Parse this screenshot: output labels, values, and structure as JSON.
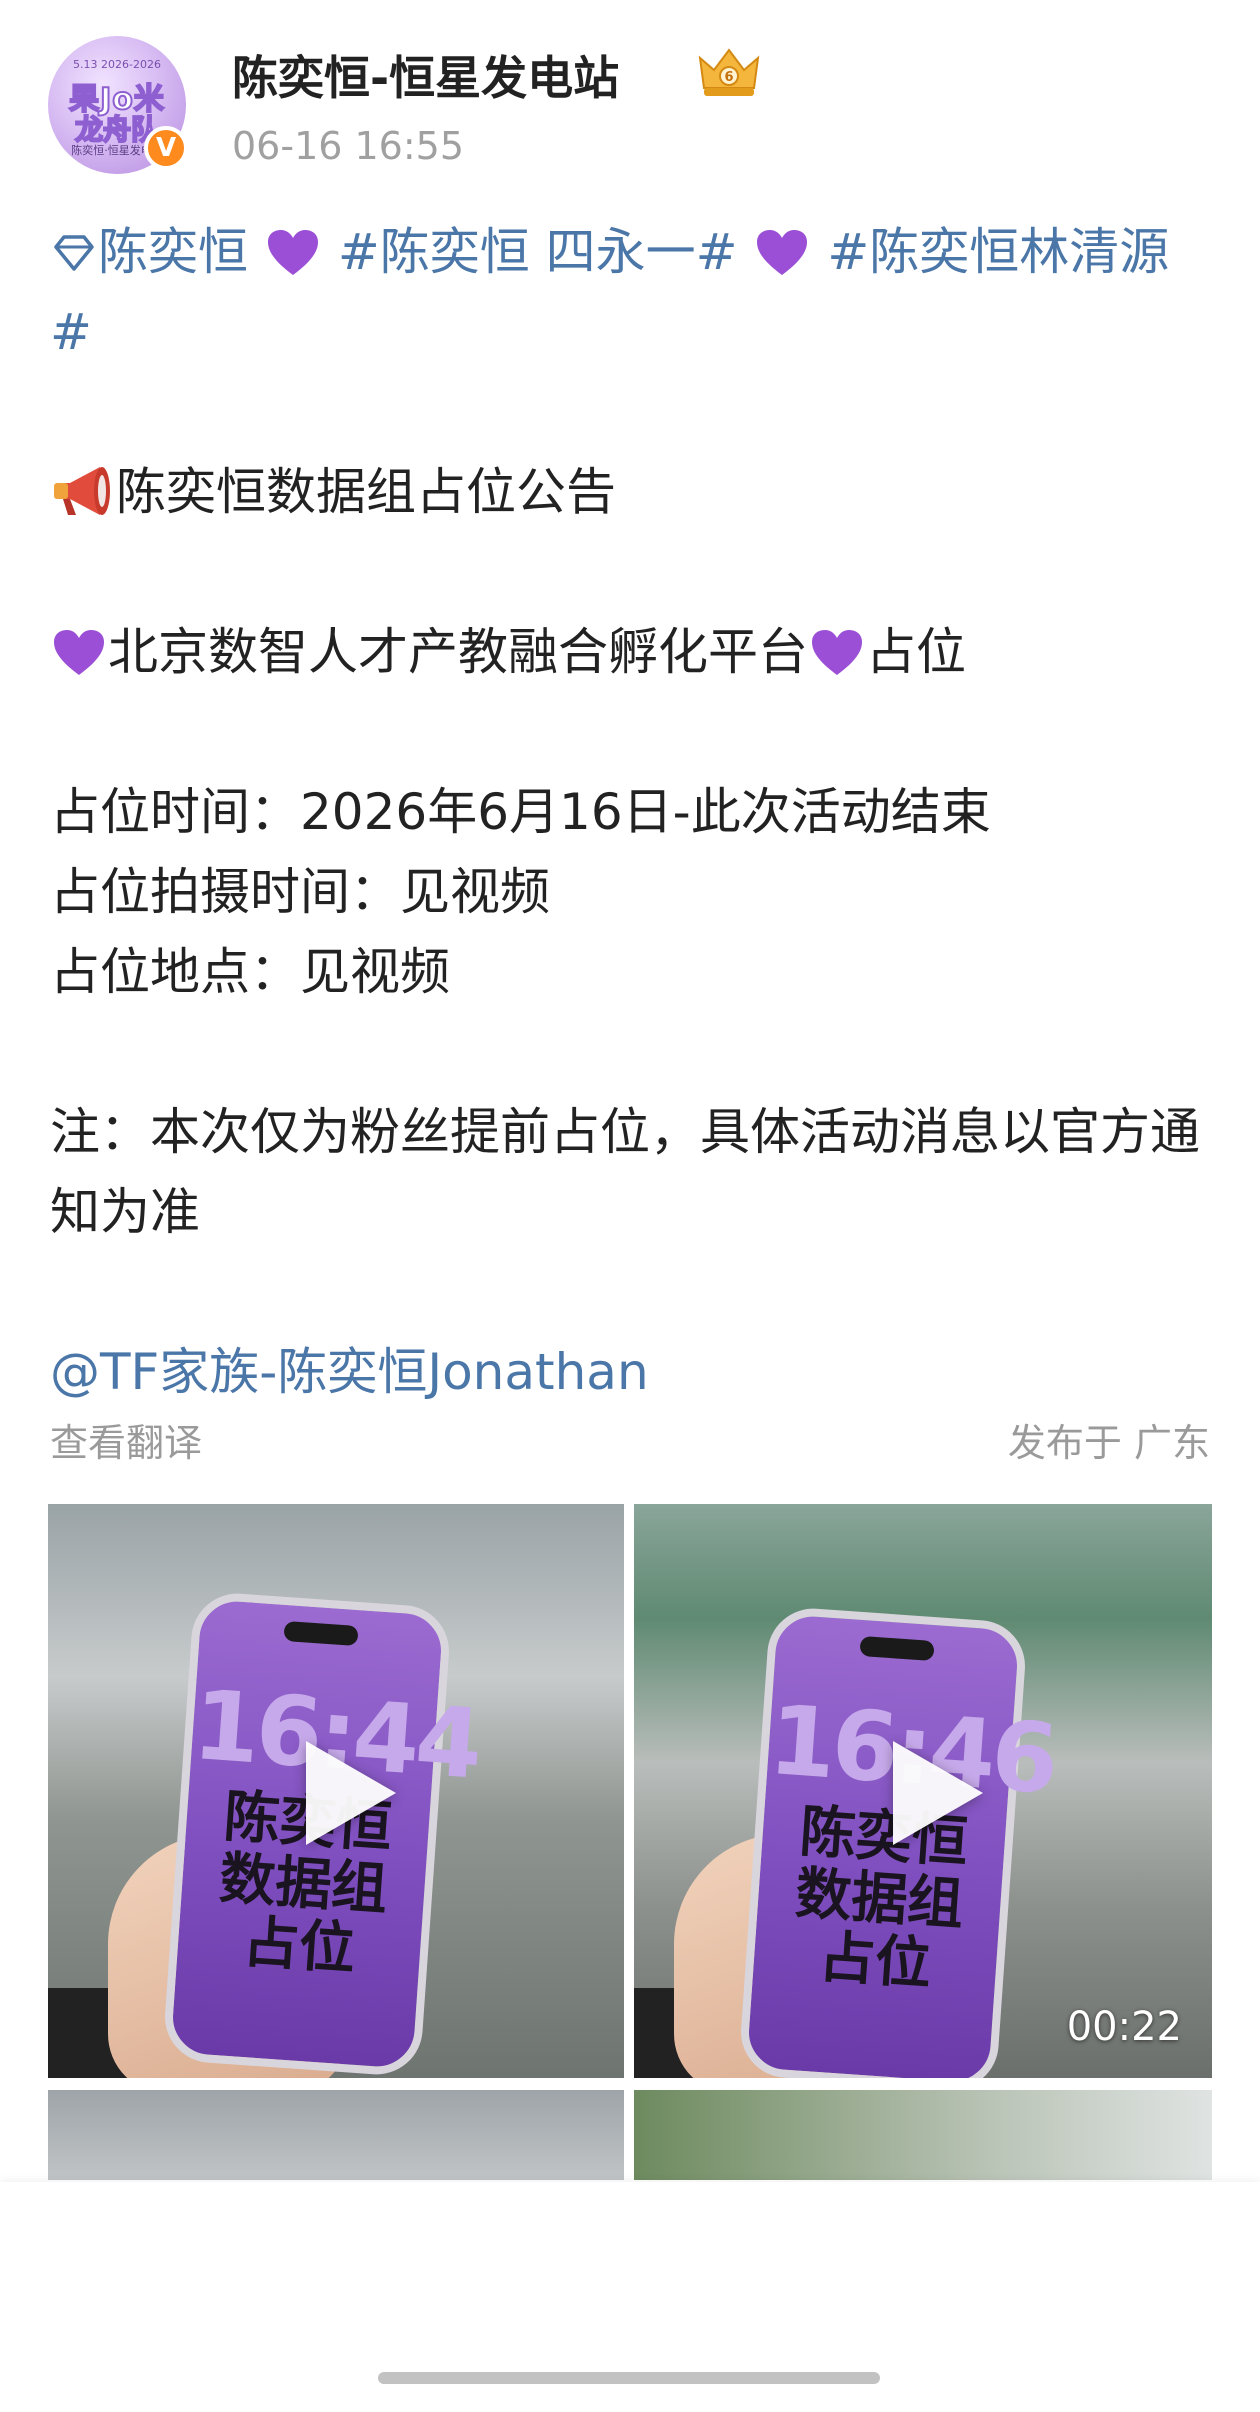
{
  "author": {
    "name": "陈奕恒-恒星发电站",
    "timestamp": "06-16 16:55",
    "avatar_text": {
      "top": "5.13 2026-2026",
      "line1": "果Jo米",
      "line2": "龙舟队",
      "bottom": "陈奕恒·恒星发电站"
    },
    "verified_mark": "V",
    "level_icon": "crown-level-badge-icon"
  },
  "post": {
    "tag_lead": "陈奕恒",
    "tag_2": "#陈奕恒 四永一#",
    "tag_3": "#陈奕恒林清源#",
    "announcement": "陈奕恒数据组占位公告",
    "platform": "北京数智人才产教融合孵化平台",
    "platform_suffix": "占位",
    "time_line": "占位时间：2026年6月16日-此次活动结束",
    "shoot_line": "占位拍摄时间：见视频",
    "place_line": "占位地点：见视频",
    "note": "注：本次仅为粉丝提前占位，具体活动消息以官方通知为准",
    "mention": "@TF家族-陈奕恒Jonathan"
  },
  "meta": {
    "translate": "查看翻译",
    "location": "发布于 广东"
  },
  "media": {
    "video_1": {
      "clock": "16:44",
      "lock_text": "陈奕恒数据组占位"
    },
    "video_2": {
      "clock": "16:46",
      "lock_text": "陈奕恒数据组占位",
      "duration": "00:22"
    }
  },
  "colors": {
    "link": "#4a76a8",
    "heart": "#9b4fd6",
    "badge": "#ff8a1d"
  }
}
